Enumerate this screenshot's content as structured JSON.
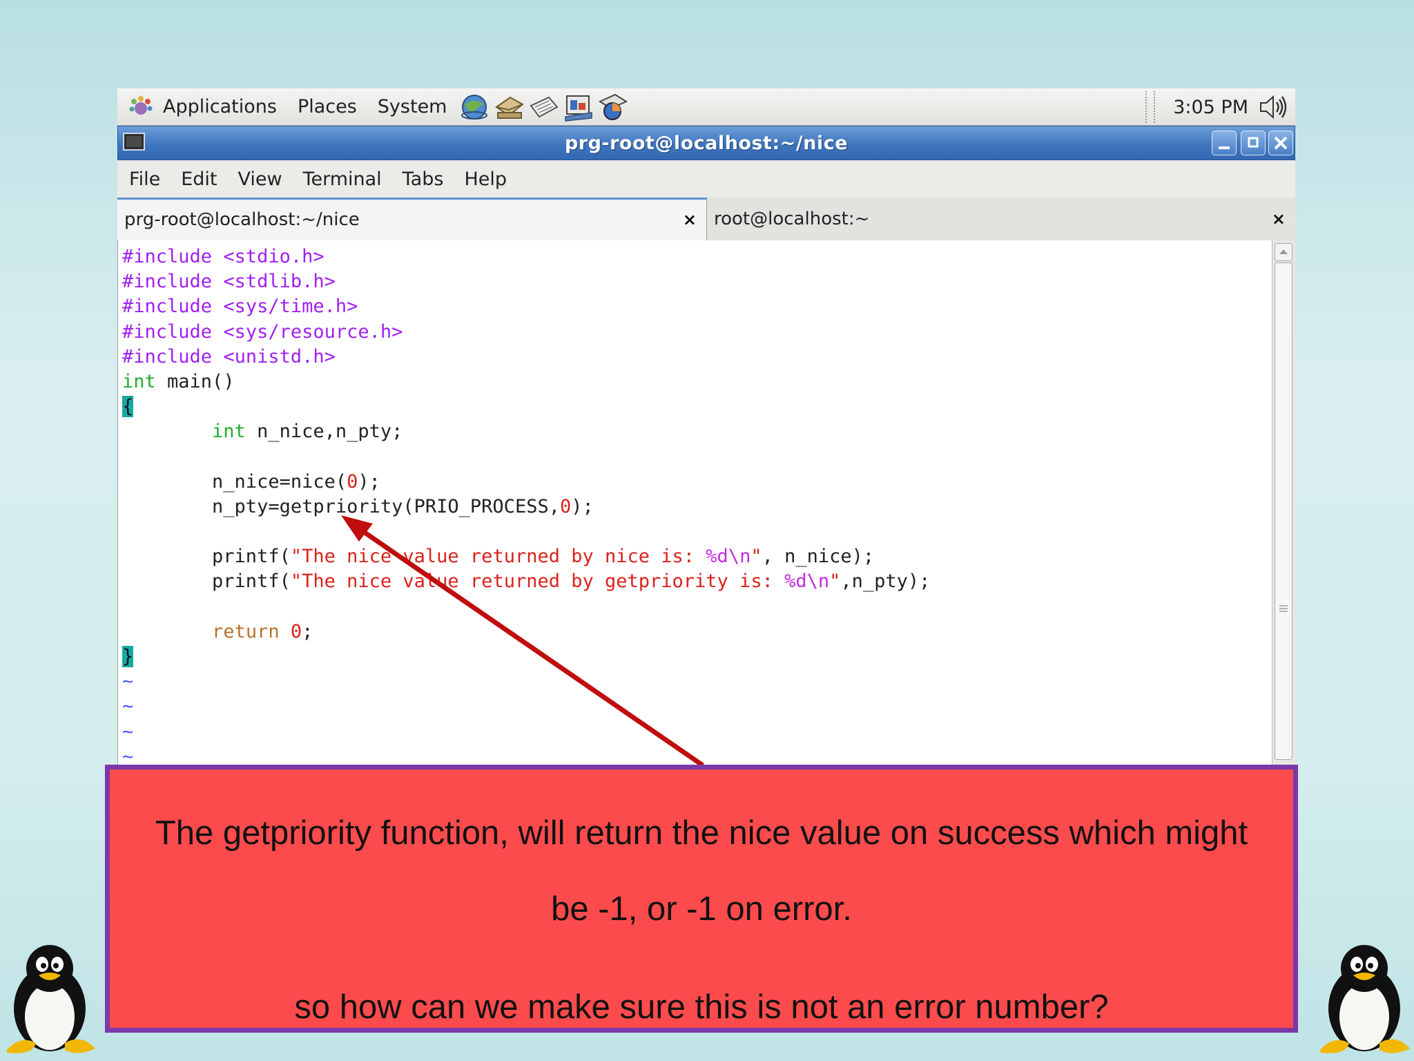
{
  "panel": {
    "menus": [
      "Applications",
      "Places",
      "System"
    ],
    "launcher_icons": [
      "web-browser-icon",
      "email-icon",
      "notes-icon",
      "presentation-icon",
      "chart-icon"
    ],
    "clock": "3:05 PM"
  },
  "window": {
    "title": "prg-root@localhost:~/nice",
    "menu": [
      "File",
      "Edit",
      "View",
      "Terminal",
      "Tabs",
      "Help"
    ],
    "tabs": [
      {
        "label": "prg-root@localhost:~/nice",
        "active": true
      },
      {
        "label": "root@localhost:~",
        "active": false
      }
    ],
    "tab_close": "×"
  },
  "editor": {
    "lines": [
      "#include <stdio.h>",
      "#include <stdlib.h>",
      "#include <sys/time.h>",
      "#include <sys/resource.h>",
      "#include <unistd.h>",
      "int main()",
      "{",
      "        int n_nice,n_pty;",
      "",
      "        n_nice=nice(0);",
      "        n_pty=getpriority(PRIO_PROCESS,0);",
      "",
      "        printf(\"The nice value returned by nice is: %d\\n\", n_nice);",
      "        printf(\"The nice value returned by getpriority is: %d\\n\",n_pty);",
      "",
      "        return 0;",
      "}",
      "~",
      "~",
      "~",
      "~"
    ]
  },
  "callout": {
    "line1": "The getpriority function, will return the nice value on success which might",
    "line2": "be -1, or -1 on error.",
    "line3": "so how can we make sure this is not an error number?",
    "arrow_color": "#c00d0d",
    "fill_color": "#fb4b4c",
    "border_color": "#7a39a8"
  }
}
